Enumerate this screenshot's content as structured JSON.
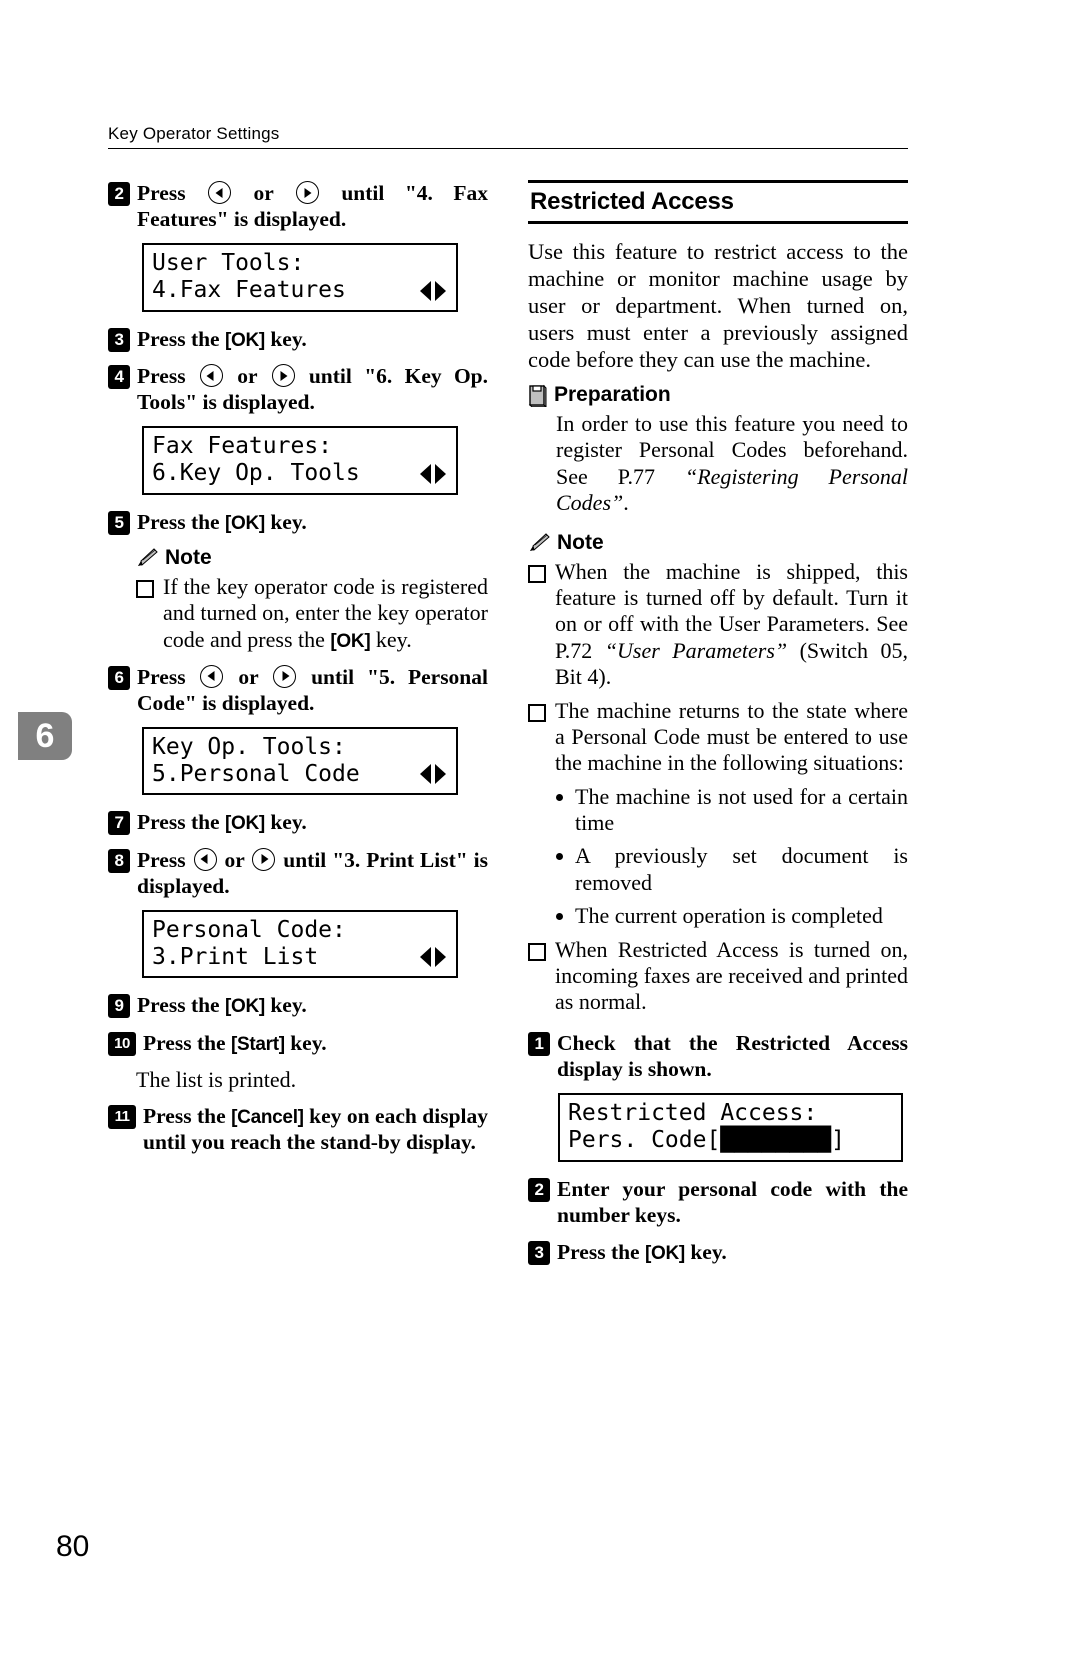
{
  "header": {
    "title": "Key Operator Settings"
  },
  "chapter_tab": "6",
  "folio": "80",
  "icons": {
    "note": "pencil-icon",
    "preparation": "book-icon",
    "arrow_left": "arrow-left-icon",
    "arrow_right": "arrow-right-icon",
    "note_bullet": "square-bullet-icon"
  },
  "left_column": {
    "steps": [
      {
        "num": "2",
        "text_parts": {
          "a": "Press ",
          "b": " or ",
          "c": " until \"4. Fax Features\" is displayed."
        }
      },
      {
        "num": "3",
        "text_before": "Press the ",
        "key": "[OK]",
        "text_after": " key."
      },
      {
        "num": "4",
        "text_parts": {
          "a": "Press ",
          "b": " or ",
          "c": " until \"6. Key Op. Tools\" is displayed."
        }
      },
      {
        "num": "5",
        "text_before": "Press the ",
        "key": "[OK]",
        "text_after": " key."
      },
      {
        "num": "6",
        "text_parts": {
          "a": "Press ",
          "b": " or ",
          "c": " until \"5. Personal Code\" is displayed."
        }
      },
      {
        "num": "7",
        "text_before": "Press the ",
        "key": "[OK]",
        "text_after": " key."
      },
      {
        "num": "8",
        "text_parts": {
          "a": "Press ",
          "b": " or ",
          "c": " until \"3. Print List\" is displayed."
        }
      },
      {
        "num": "9",
        "text_before": "Press the ",
        "key": "[OK]",
        "text_after": " key."
      },
      {
        "num": "10",
        "text_before": "Press the ",
        "key": "[Start]",
        "text_after": " key."
      },
      {
        "num": "11",
        "text_before": "Press the ",
        "key": "[Cancel]",
        "text_after": " key on each display until you reach the stand-by display."
      }
    ],
    "lcd_1": {
      "line1": "User Tools:",
      "line2": "4.Fax Features"
    },
    "lcd_2": {
      "line1": "Fax Features:",
      "line2": "6.Key Op. Tools"
    },
    "lcd_3": {
      "line1": "Key Op. Tools:",
      "line2": "5.Personal Code"
    },
    "lcd_4": {
      "line1": "Personal Code:",
      "line2": "3.Print List"
    },
    "note": {
      "label": "Note",
      "item_before": "If the key operator code is registered and turned on, enter the key operator code and press the ",
      "item_key": "[OK]",
      "item_after": " key."
    },
    "result_text": "The list is printed."
  },
  "right_column": {
    "section_title": "Restricted Access",
    "intro": "Use this feature to restrict access to the machine or monitor machine usage by user or department. When turned on, users must enter a previously assigned code before they can use the machine.",
    "preparation": {
      "label": "Preparation",
      "text_plain_1": "In order to use this feature you need to register Personal Codes beforehand. See P.77 ",
      "text_italic": "“Registering Personal Codes”",
      "text_plain_2": "."
    },
    "note": {
      "label": "Note",
      "items": [
        {
          "plain_1": "When the machine is shipped, this feature is turned off by default. Turn it on or off with the User Parameters. See P.72 ",
          "italic": "“User Parameters”",
          "plain_2": " (Switch 05, Bit 4)."
        },
        {
          "plain_1": "The machine returns to the state where a Personal Code must be entered to use the machine in the following situations:",
          "italic": "",
          "plain_2": ""
        },
        {
          "plain_1": "When Restricted Access is turned on, incoming faxes are received and printed as normal.",
          "italic": "",
          "plain_2": ""
        }
      ],
      "bullets": [
        "The machine is not used for a certain time",
        "A previously set document is removed",
        "The current operation is completed"
      ]
    },
    "steps": [
      {
        "num": "1",
        "text": "Check that the Restricted Access display is shown."
      },
      {
        "num": "2",
        "text": "Enter your personal code with the number keys."
      },
      {
        "num": "3",
        "text_before": "Press the ",
        "key": "[OK]",
        "text_after": " key."
      }
    ],
    "lcd_1": {
      "line1": "Restricted Access:",
      "line2": "Pers. Code[████████]"
    }
  }
}
